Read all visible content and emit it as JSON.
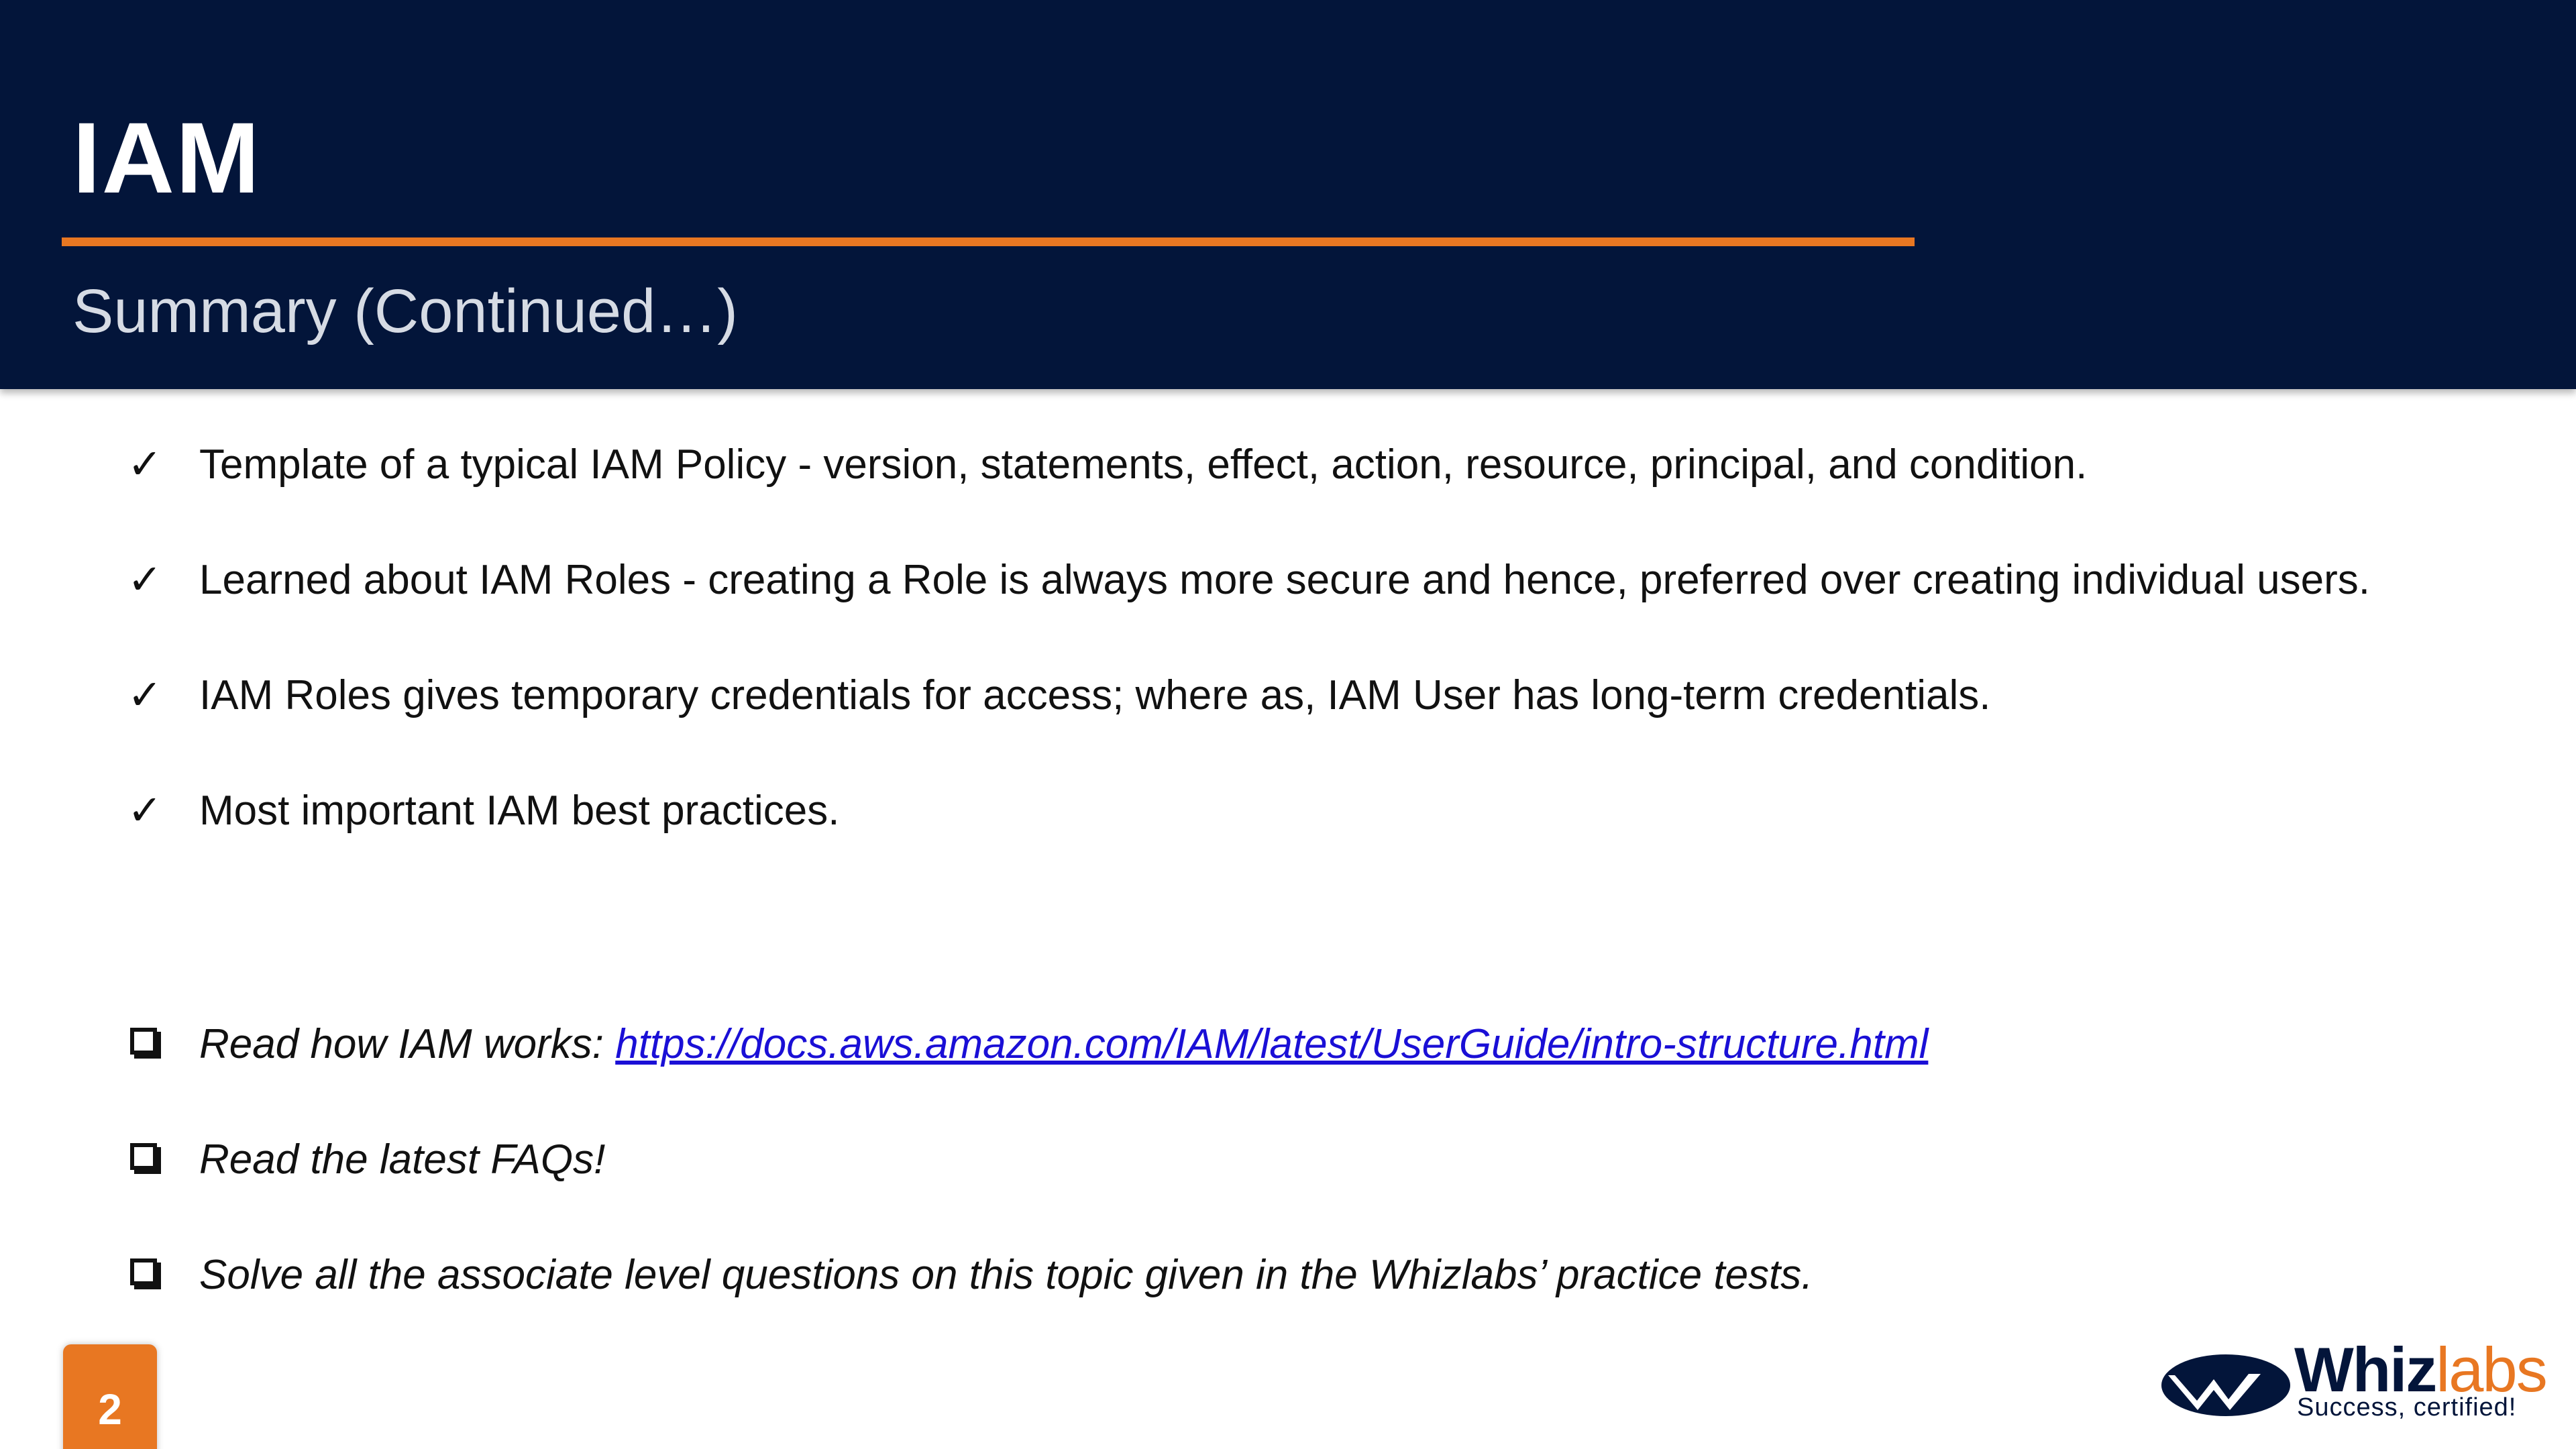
{
  "header": {
    "title": "IAM",
    "subtitle": "Summary (Continued…)"
  },
  "check_items": [
    {
      "mark": "✓",
      "text": "Template of a typical IAM Policy - version, statements, effect, action, resource, principal, and condition."
    },
    {
      "mark": "✓",
      "text": "Learned about IAM Roles - creating a Role is always more secure and hence, preferred over creating individual users."
    },
    {
      "mark": "✓",
      "text": "IAM Roles gives temporary credentials for access; where as, IAM User has long-term credentials."
    },
    {
      "mark": "✓",
      "text": "Most important IAM best practices."
    }
  ],
  "box_items": [
    {
      "text": "Read how IAM works: ",
      "link": "https://docs.aws.amazon.com/IAM/latest/UserGuide/intro-structure.html"
    },
    {
      "text": "Read the latest FAQs!"
    },
    {
      "text": "Solve all the associate level questions on this topic given in the Whizlabs’ practice tests."
    }
  ],
  "footer": {
    "page_number": "2",
    "logo_name_main": "Whiz",
    "logo_name_accent": "labs",
    "logo_tagline": "Success, certified!"
  },
  "colors": {
    "header_bg": "#03153a",
    "accent": "#e87722",
    "link": "#1a0fd6"
  }
}
